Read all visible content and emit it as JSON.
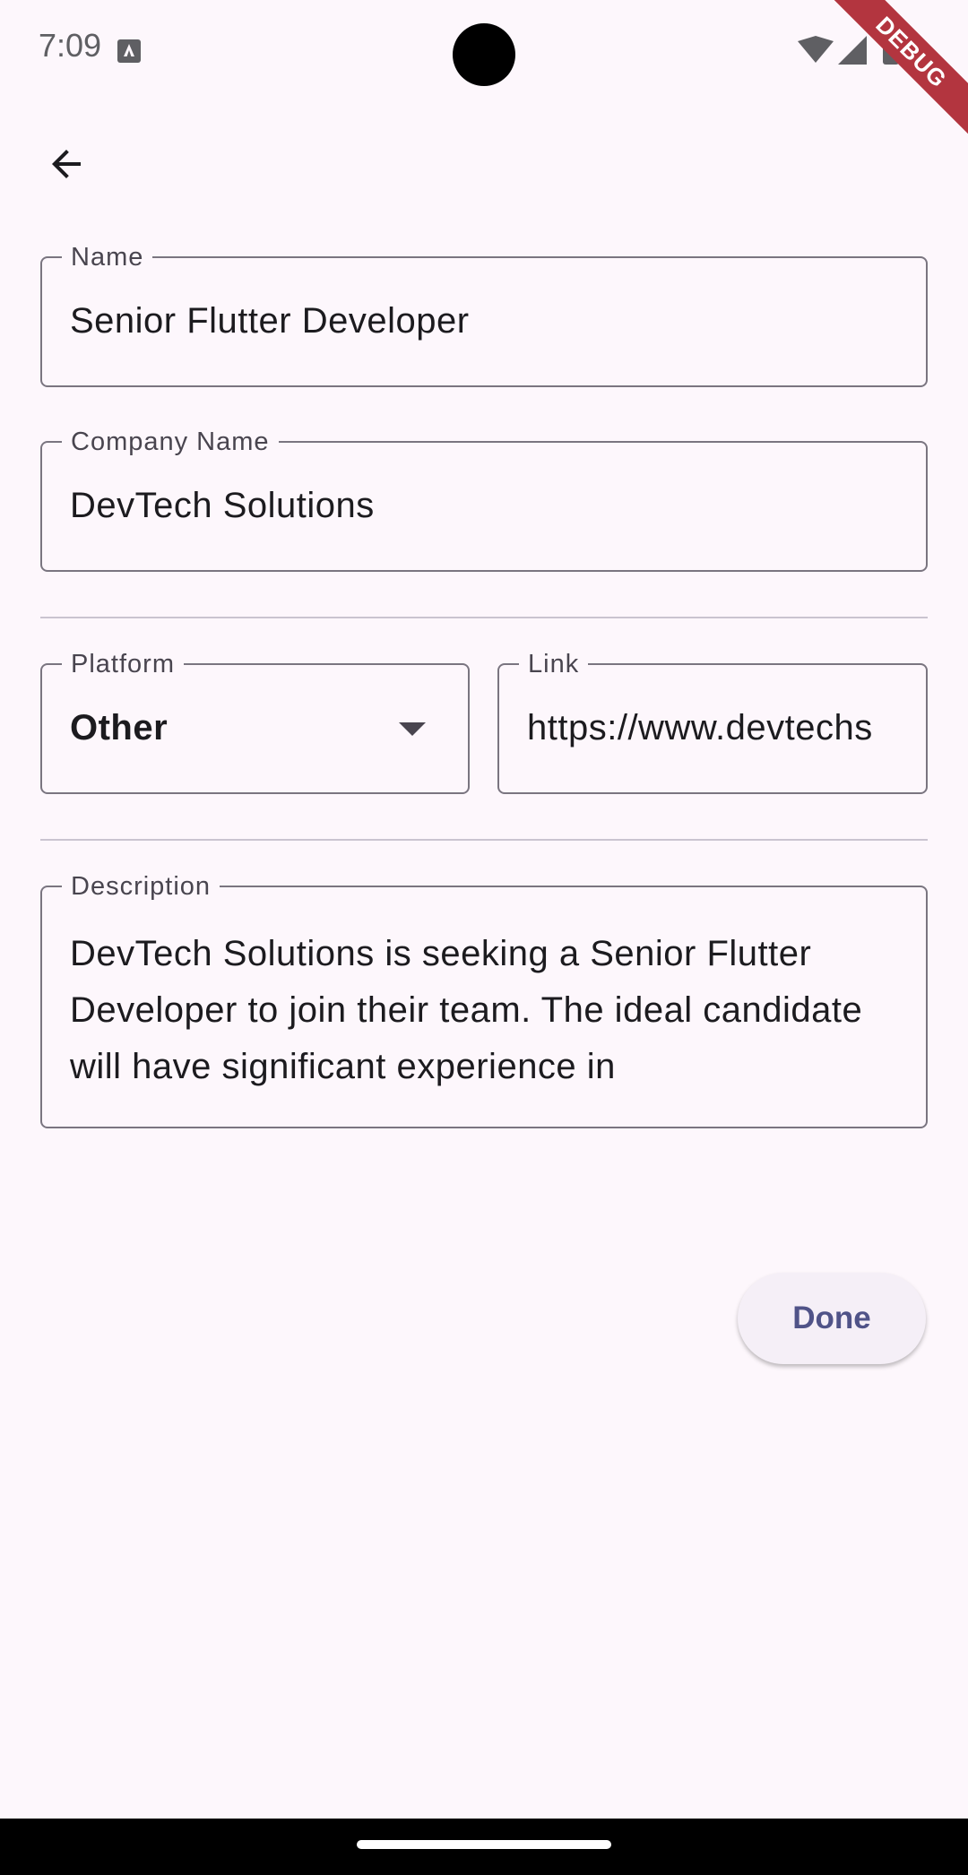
{
  "status_bar": {
    "time": "7:09"
  },
  "debug_banner": "DEBUG",
  "icons": {
    "back": "arrow-back-icon",
    "dropdown": "arrow-drop-down-icon",
    "wifi": "wifi-icon",
    "signal": "signal-icon",
    "battery": "battery-icon"
  },
  "form": {
    "name": {
      "label": "Name",
      "value": "Senior Flutter Developer"
    },
    "company": {
      "label": "Company Name",
      "value": "DevTech Solutions"
    },
    "platform": {
      "label": "Platform",
      "value": "Other"
    },
    "link": {
      "label": "Link",
      "value": "https://www.devtechs"
    },
    "description": {
      "label": "Description",
      "value": "DevTech Solutions is seeking a Senior Flutter Developer to join their team. The ideal candidate will have significant experience in"
    }
  },
  "actions": {
    "done_label": "Done"
  },
  "colors": {
    "background": "#fdf7fc",
    "outline": "#7a7580",
    "primary_text": "#505388",
    "debug": "#b3353f"
  }
}
